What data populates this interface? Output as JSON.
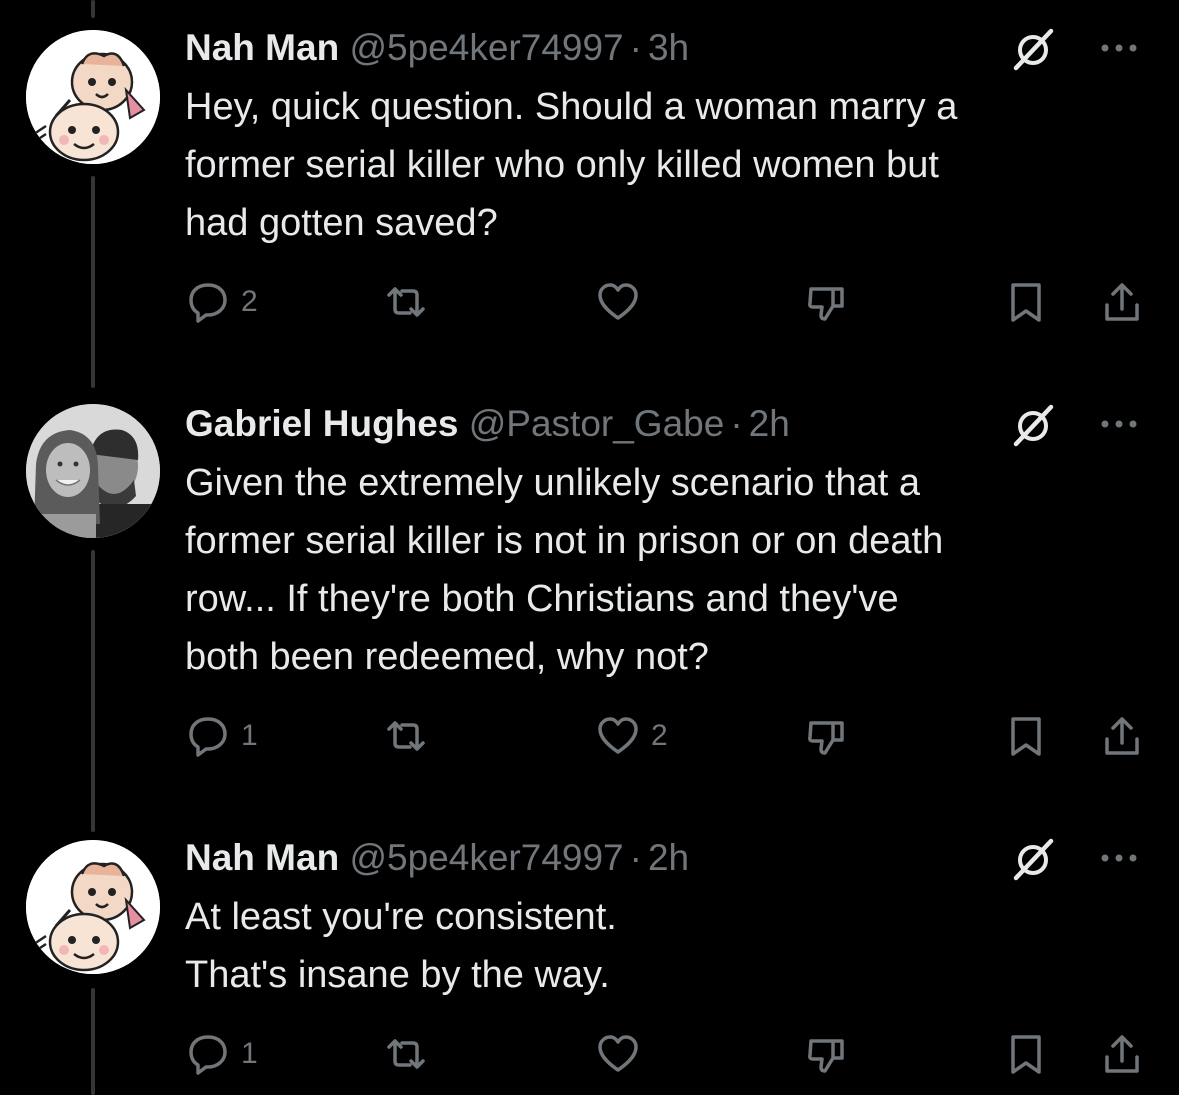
{
  "colors": {
    "background": "#000000",
    "text": "#e7e9ea",
    "muted": "#71767b",
    "thread_line": "#333639"
  },
  "tweets": [
    {
      "display_name": "Nah Man",
      "handle": "@5pe4ker74997",
      "dot": "·",
      "time": "3h",
      "avatar": "cartoon-babies-avatar",
      "lines": [
        "Hey, quick question. Should a woman marry a",
        "former serial killer who only killed women but",
        "had gotten saved?"
      ],
      "replies": "2",
      "reposts": "",
      "likes": "",
      "views": ""
    },
    {
      "display_name": "Gabriel Hughes",
      "handle": "@Pastor_Gabe",
      "dot": "·",
      "time": "2h",
      "avatar": "couple-photo-avatar",
      "lines": [
        "Given the extremely unlikely scenario that a",
        "former serial killer is not in prison or on death",
        "row... If they're both Christians and they've",
        "both been redeemed, why not?"
      ],
      "replies": "1",
      "reposts": "",
      "likes": "2",
      "views": ""
    },
    {
      "display_name": "Nah Man",
      "handle": "@5pe4ker74997",
      "dot": "·",
      "time": "2h",
      "avatar": "cartoon-babies-avatar",
      "lines": [
        "At least you're consistent.",
        "That's insane by the way."
      ],
      "replies": "1",
      "reposts": "",
      "likes": "",
      "views": ""
    }
  ]
}
